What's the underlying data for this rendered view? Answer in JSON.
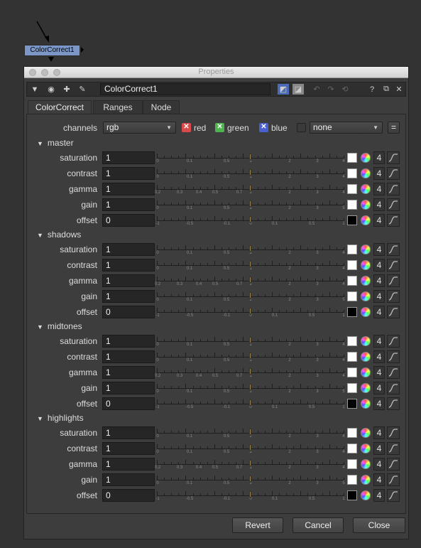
{
  "node_graph": {
    "node_label": "ColorCorrect1"
  },
  "window": {
    "title": "Properties"
  },
  "toolbar": {
    "node_name": "ColorCorrect1",
    "help_label": "?"
  },
  "tabs": [
    {
      "label": "ColorCorrect",
      "active": true
    },
    {
      "label": "Ranges",
      "active": false
    },
    {
      "label": "Node",
      "active": false
    }
  ],
  "channels": {
    "label": "channels",
    "value": "rgb",
    "red": "red",
    "green": "green",
    "blue": "blue",
    "mask_value": "none",
    "eq_label": "="
  },
  "ticks": {
    "linear": [
      "0",
      "0.1",
      "0.5",
      "1",
      "2",
      "3",
      "4"
    ],
    "gamma": [
      "0.2",
      "0.3",
      "0.4",
      "0.5",
      "0.7",
      "1",
      "2",
      "3",
      "4"
    ],
    "gain": [
      "0",
      "0.1",
      "0.5",
      "1",
      "2",
      "3",
      "5"
    ],
    "offset": [
      "-1",
      "-0.5",
      "-0.1",
      "0",
      "0.1",
      "0.5",
      "1"
    ]
  },
  "sections": [
    {
      "name": "master",
      "params": [
        {
          "label": "saturation",
          "value": "1",
          "scale": "linear",
          "swatch": "#ffffff"
        },
        {
          "label": "contrast",
          "value": "1",
          "scale": "linear",
          "swatch": "#ffffff"
        },
        {
          "label": "gamma",
          "value": "1",
          "scale": "gamma",
          "swatch": "#ffffff"
        },
        {
          "label": "gain",
          "value": "1",
          "scale": "gain",
          "swatch": "#ffffff"
        },
        {
          "label": "offset",
          "value": "0",
          "scale": "offset",
          "swatch": "#000000"
        }
      ]
    },
    {
      "name": "shadows",
      "params": [
        {
          "label": "saturation",
          "value": "1",
          "scale": "linear",
          "swatch": "#ffffff"
        },
        {
          "label": "contrast",
          "value": "1",
          "scale": "linear",
          "swatch": "#ffffff"
        },
        {
          "label": "gamma",
          "value": "1",
          "scale": "gamma",
          "swatch": "#ffffff"
        },
        {
          "label": "gain",
          "value": "1",
          "scale": "gain",
          "swatch": "#ffffff"
        },
        {
          "label": "offset",
          "value": "0",
          "scale": "offset",
          "swatch": "#000000"
        }
      ]
    },
    {
      "name": "midtones",
      "params": [
        {
          "label": "saturation",
          "value": "1",
          "scale": "linear",
          "swatch": "#ffffff"
        },
        {
          "label": "contrast",
          "value": "1",
          "scale": "linear",
          "swatch": "#ffffff"
        },
        {
          "label": "gamma",
          "value": "1",
          "scale": "gamma",
          "swatch": "#ffffff"
        },
        {
          "label": "gain",
          "value": "1",
          "scale": "gain",
          "swatch": "#ffffff"
        },
        {
          "label": "offset",
          "value": "0",
          "scale": "offset",
          "swatch": "#000000"
        }
      ]
    },
    {
      "name": "highlights",
      "params": [
        {
          "label": "saturation",
          "value": "1",
          "scale": "linear",
          "swatch": "#ffffff"
        },
        {
          "label": "contrast",
          "value": "1",
          "scale": "linear",
          "swatch": "#ffffff"
        },
        {
          "label": "gamma",
          "value": "1",
          "scale": "gamma",
          "swatch": "#ffffff"
        },
        {
          "label": "gain",
          "value": "1",
          "scale": "gain",
          "swatch": "#ffffff"
        },
        {
          "label": "offset",
          "value": "0",
          "scale": "offset",
          "swatch": "#000000"
        }
      ]
    }
  ],
  "channel_count_label": "4",
  "buttons": {
    "revert": "Revert",
    "cancel": "Cancel",
    "close": "Close"
  },
  "colors": {
    "node": "#7a97c8",
    "red_check": "#d94b4b",
    "green_check": "#4fb34f",
    "blue_check": "#4a5fd0",
    "knob": "#9a8650"
  }
}
